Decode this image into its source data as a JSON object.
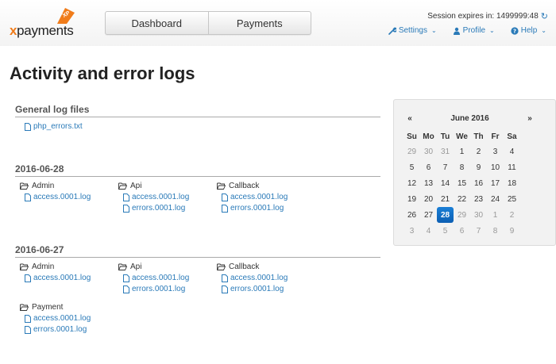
{
  "header": {
    "logo_text_x": "x",
    "logo_text_rest": "payments",
    "logo_badge": "XP",
    "nav": [
      "Dashboard",
      "Payments"
    ],
    "session_text": "Session expires in: 1499999:48",
    "links": {
      "settings": "Settings",
      "profile": "Profile",
      "help": "Help"
    }
  },
  "page": {
    "title": "Activity and error logs"
  },
  "general": {
    "title": "General log files",
    "files": [
      "php_errors.txt"
    ]
  },
  "sections": [
    {
      "title": "2016-06-28",
      "groups": [
        {
          "name": "Admin",
          "files": [
            "access.0001.log"
          ]
        },
        {
          "name": "Api",
          "files": [
            "access.0001.log",
            "errors.0001.log"
          ]
        },
        {
          "name": "Callback",
          "files": [
            "access.0001.log",
            "errors.0001.log"
          ]
        }
      ]
    },
    {
      "title": "2016-06-27",
      "groups": [
        {
          "name": "Admin",
          "files": [
            "access.0001.log"
          ]
        },
        {
          "name": "Api",
          "files": [
            "access.0001.log",
            "errors.0001.log"
          ]
        },
        {
          "name": "Callback",
          "files": [
            "access.0001.log",
            "errors.0001.log"
          ]
        },
        {
          "name": "Payment",
          "files": [
            "access.0001.log",
            "errors.0001.log"
          ]
        }
      ]
    }
  ],
  "calendar": {
    "prev": "«",
    "next": "»",
    "month": "June 2016",
    "dow": [
      "Su",
      "Mo",
      "Tu",
      "We",
      "Th",
      "Fr",
      "Sa"
    ],
    "days": [
      {
        "d": "29",
        "m": true
      },
      {
        "d": "30",
        "m": true
      },
      {
        "d": "31",
        "m": true
      },
      {
        "d": "1"
      },
      {
        "d": "2"
      },
      {
        "d": "3"
      },
      {
        "d": "4"
      },
      {
        "d": "5"
      },
      {
        "d": "6"
      },
      {
        "d": "7"
      },
      {
        "d": "8"
      },
      {
        "d": "9"
      },
      {
        "d": "10"
      },
      {
        "d": "11"
      },
      {
        "d": "12"
      },
      {
        "d": "13"
      },
      {
        "d": "14"
      },
      {
        "d": "15"
      },
      {
        "d": "16"
      },
      {
        "d": "17"
      },
      {
        "d": "18"
      },
      {
        "d": "19"
      },
      {
        "d": "20"
      },
      {
        "d": "21"
      },
      {
        "d": "22"
      },
      {
        "d": "23"
      },
      {
        "d": "24"
      },
      {
        "d": "25"
      },
      {
        "d": "26"
      },
      {
        "d": "27"
      },
      {
        "d": "28",
        "s": true
      },
      {
        "d": "29",
        "m": true
      },
      {
        "d": "30",
        "m": true
      },
      {
        "d": "1",
        "m": true
      },
      {
        "d": "2",
        "m": true
      },
      {
        "d": "3",
        "m": true
      },
      {
        "d": "4",
        "m": true
      },
      {
        "d": "5",
        "m": true
      },
      {
        "d": "6",
        "m": true
      },
      {
        "d": "7",
        "m": true
      },
      {
        "d": "8",
        "m": true
      },
      {
        "d": "9",
        "m": true
      }
    ]
  },
  "colors": {
    "link": "#2a7ab8",
    "brand": "#f07c1a",
    "selected": "#1a7fd6"
  }
}
